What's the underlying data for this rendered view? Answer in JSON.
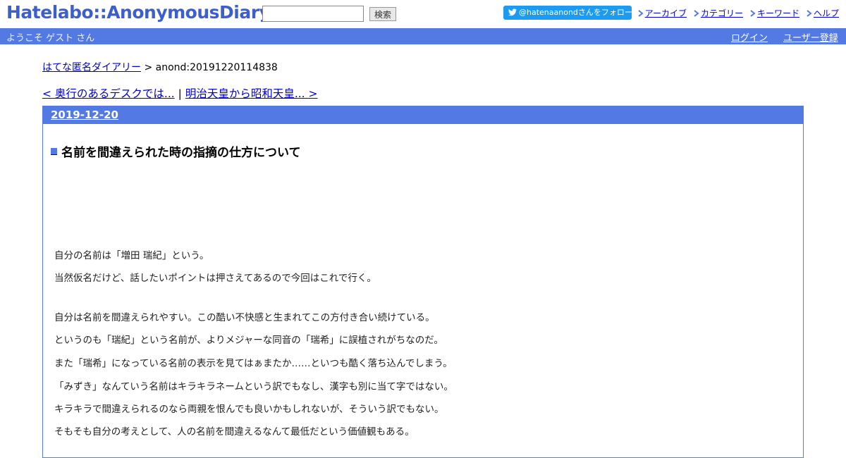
{
  "header": {
    "logo": "Hatelabo::AnonymousDiary",
    "search": {
      "value": "",
      "placeholder": "",
      "button": "検索"
    },
    "follow_button": "@hatenaanondさんをフォロー",
    "links": [
      "アーカイブ",
      "カテゴリー",
      "キーワード",
      "ヘルプ"
    ]
  },
  "bar": {
    "welcome": "ようこそ ゲスト さん",
    "login": "ログイン",
    "register": "ユーザー登録"
  },
  "breadcrumb": {
    "home": "はてな匿名ダイアリー",
    "separator": ">",
    "current": "anond:20191220114838"
  },
  "pager": {
    "prev": "< 奥行のあるデスクでは...",
    "divider": "|",
    "next": "明治天皇から昭和天皇... >"
  },
  "day": {
    "date": "2019-12-20",
    "title": "名前を間違えられた時の指摘の仕方について",
    "lines": [
      "自分の名前は「増田 瑞紀」という。",
      "当然仮名だけど、話したいポイントは押さえてあるので今回はこれで行く。",
      "自分は名前を間違えられやすい。この酷い不快感と生まれてこの方付き合い続けている。",
      "というのも「瑞紀」という名前が、よりメジャーな同音の「瑞希」に誤植されがちなのだ。",
      "また「瑞希」になっている名前の表示を見てはぁまたか……といつも酷く落ち込んでしまう。",
      "「みずき」なんていう名前はキラキラネームという訳でもなし、漢字も別に当て字ではない。",
      "キラキラで間違えられるのなら両親を恨んでも良いかもしれないが、そういう訳でもない。",
      "そもそも自分の考えとして、人の名前を間違えるなんて最低だという価値観もある。"
    ]
  },
  "colors": {
    "accent": "#537ae2",
    "logo": "#3d5fcc",
    "twitter": "#1d9bf0",
    "link": "#0000cc"
  }
}
